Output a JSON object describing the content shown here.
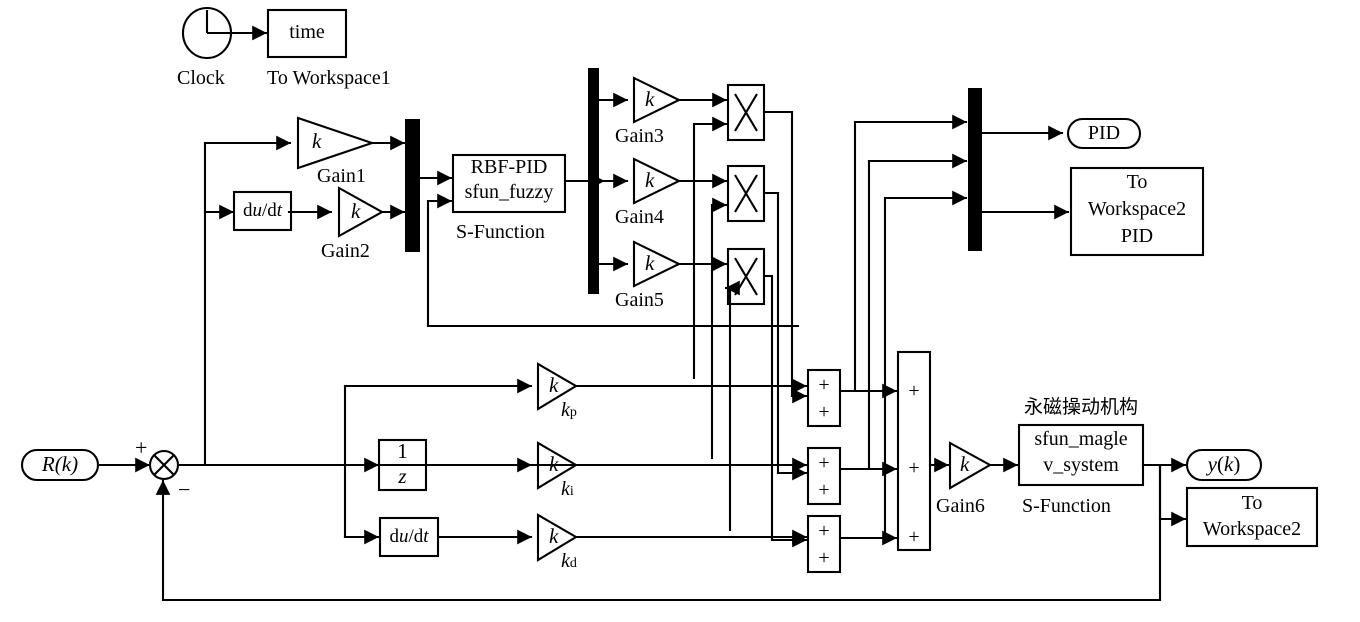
{
  "diagram": {
    "title": "RBF-PID fuzzy control of permanent magnet actuator (Simulink block diagram)",
    "type": "simulink-block-diagram",
    "line_color": "#000000",
    "background": "#ffffff"
  },
  "blocks": {
    "clock": {
      "name": "Clock",
      "label": "Clock",
      "kind": "clock"
    },
    "to_workspace1": {
      "name": "To Workspace1",
      "value": "time",
      "label": "To Workspace1",
      "kind": "to-workspace"
    },
    "gain1": {
      "symbol": "k",
      "label": "Gain1",
      "kind": "gain"
    },
    "derivative_e": {
      "value": "du/dt",
      "kind": "derivative"
    },
    "gain2": {
      "symbol": "k",
      "label": "Gain2",
      "kind": "gain"
    },
    "mux1": {
      "kind": "mux",
      "inputs": 2
    },
    "sfun_fuzzy": {
      "line1": "RBF-PID",
      "line2": "sfun_fuzzy",
      "label": "S-Function",
      "kind": "s-function"
    },
    "demux1": {
      "kind": "demux",
      "outputs": 3
    },
    "gain3": {
      "symbol": "k",
      "label": "Gain3",
      "kind": "gain"
    },
    "gain4": {
      "symbol": "k",
      "label": "Gain4",
      "kind": "gain"
    },
    "gain5": {
      "symbol": "k",
      "label": "Gain5",
      "kind": "gain"
    },
    "product1": {
      "symbol": "×",
      "kind": "product"
    },
    "product2": {
      "symbol": "×",
      "kind": "product"
    },
    "product3": {
      "symbol": "×",
      "kind": "product"
    },
    "mux2": {
      "kind": "mux",
      "inputs": 3
    },
    "pid_out": {
      "value": "PID",
      "kind": "outport"
    },
    "to_workspace2_pid": {
      "line1": "To",
      "line2": "Workspace2",
      "line3": "PID",
      "kind": "to-workspace"
    },
    "r_in": {
      "value": "R(k)",
      "kind": "inport"
    },
    "sum_error": {
      "plus": "+",
      "minus": "−",
      "kind": "sum-circle"
    },
    "gain_kp": {
      "symbol": "k",
      "label_base": "k",
      "label_sub": "p",
      "kind": "gain"
    },
    "unit_delay": {
      "num": "1",
      "den": "z",
      "kind": "unit-delay"
    },
    "gain_ki": {
      "symbol": "k",
      "label_base": "k",
      "label_sub": "i",
      "kind": "gain"
    },
    "derivative_d": {
      "value": "du/dt",
      "kind": "derivative"
    },
    "gain_kd": {
      "symbol": "k",
      "label_base": "k",
      "label_sub": "d",
      "kind": "gain"
    },
    "sum_p": {
      "sign1": "+",
      "sign2": "+",
      "kind": "sum-rect"
    },
    "sum_i": {
      "sign1": "+",
      "sign2": "+",
      "kind": "sum-rect"
    },
    "sum_d": {
      "sign1": "+",
      "sign2": "+",
      "kind": "sum-rect"
    },
    "sum_total": {
      "sign1": "+",
      "sign2": "+",
      "sign3": "+",
      "kind": "sum-rect-3"
    },
    "gain6": {
      "symbol": "k",
      "label": "Gain6",
      "kind": "gain"
    },
    "plant_caption": {
      "value": "永磁操动机构"
    },
    "sfun_maglev": {
      "line1": "sfun_magle",
      "line2": "v_system",
      "label": "S-Function",
      "kind": "s-function"
    },
    "y_out": {
      "value": "y(k)",
      "kind": "outport"
    },
    "to_workspace2_y": {
      "line1": "To",
      "line2": "Workspace2",
      "kind": "to-workspace"
    }
  }
}
